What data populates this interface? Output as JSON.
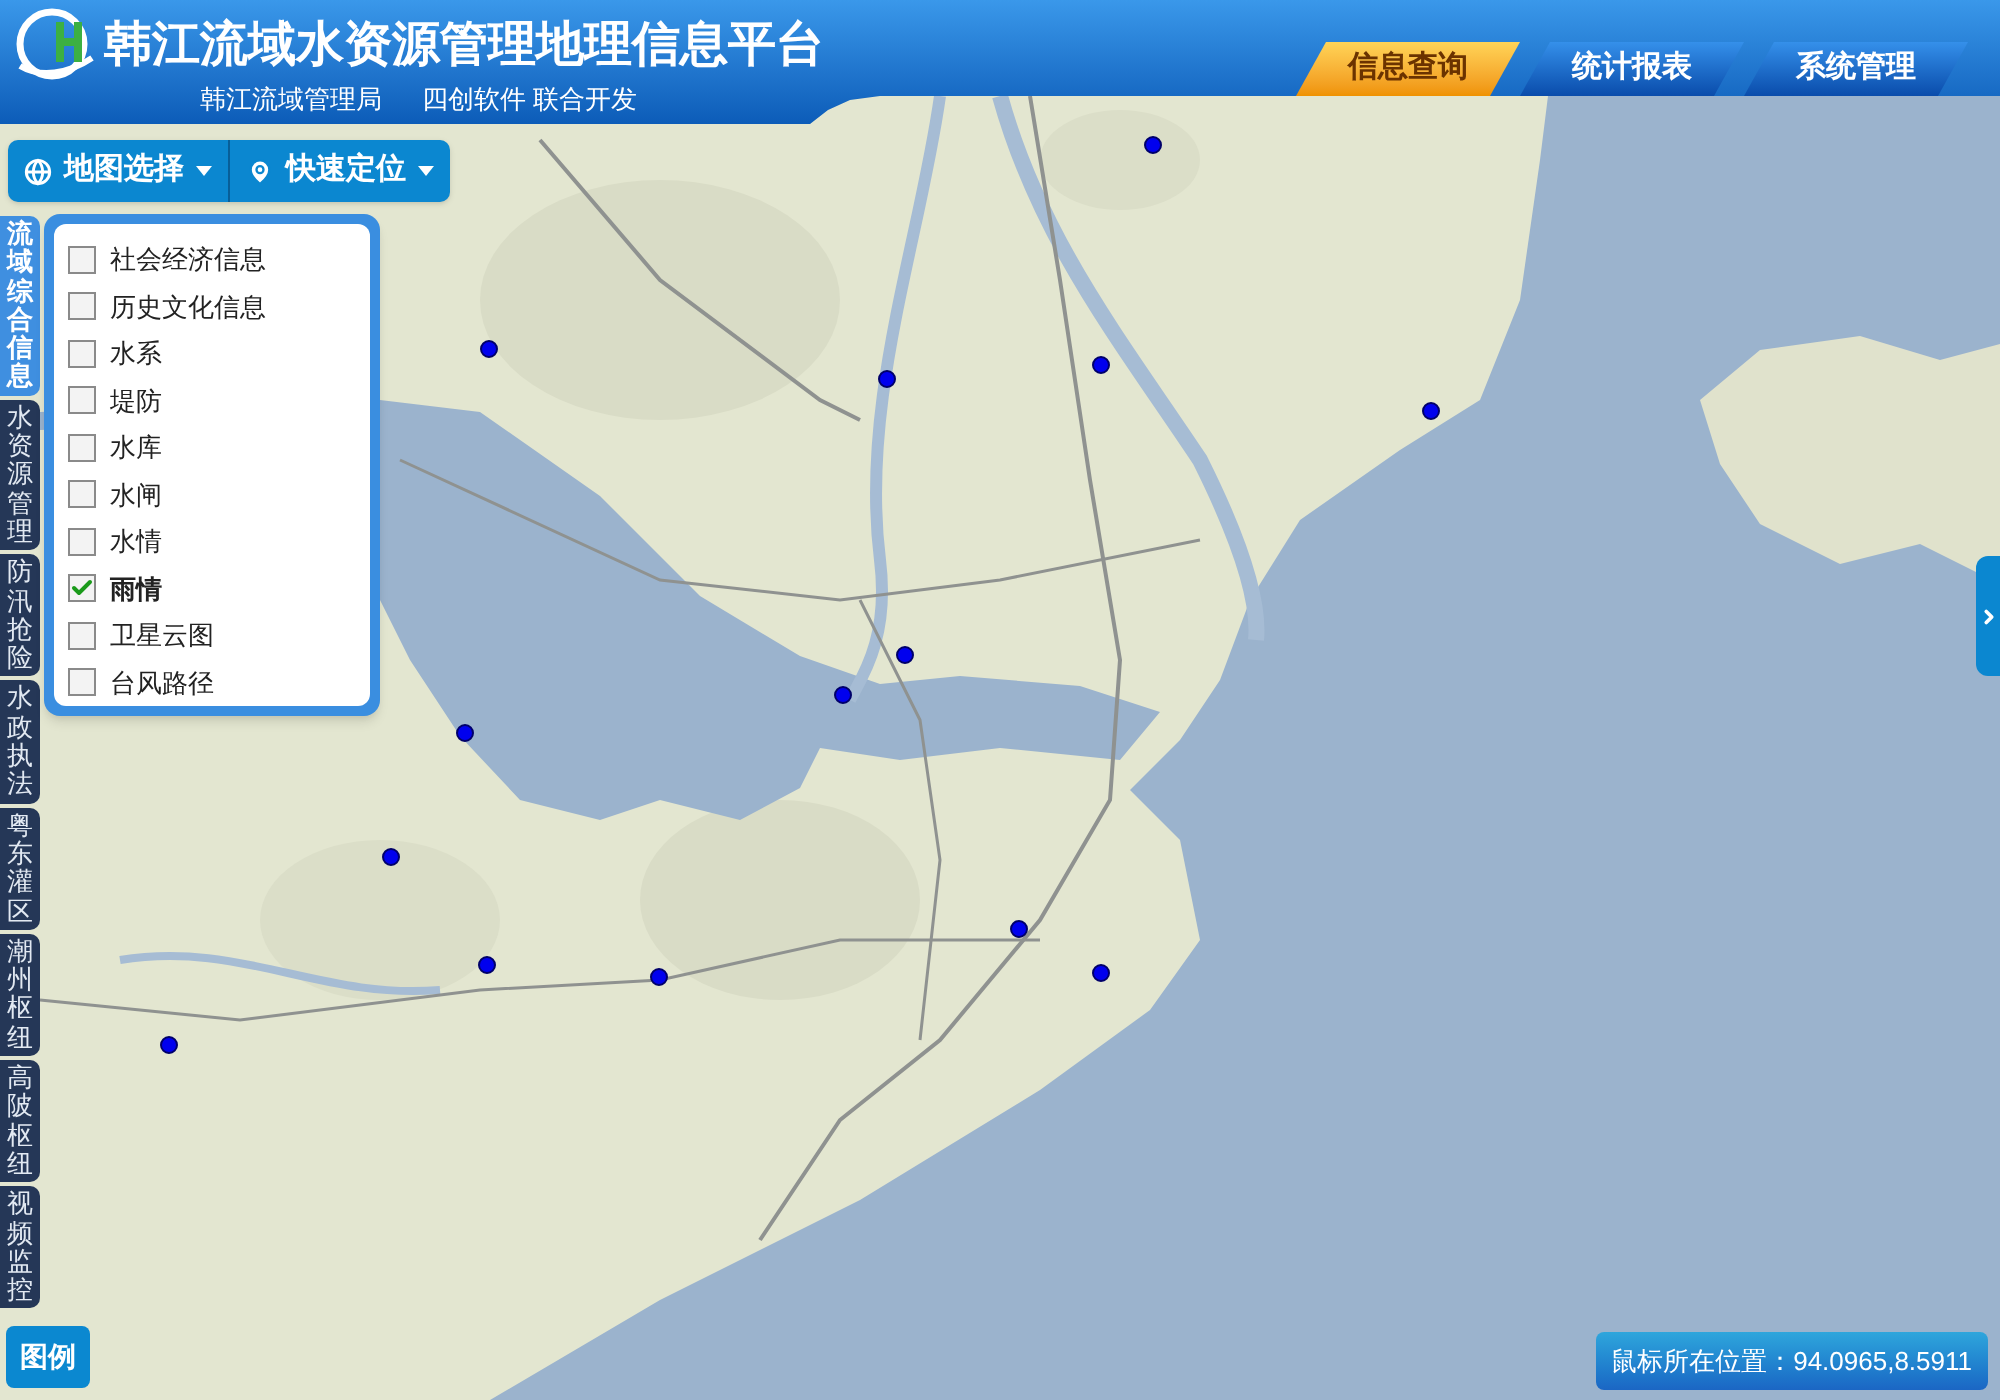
{
  "header": {
    "title": "韩江流域水资源管理地理信息平台",
    "subtitle": [
      "韩江流域管理局",
      "四创软件 联合开发"
    ]
  },
  "nav_tabs": [
    {
      "label": "信息查询",
      "selected": true
    },
    {
      "label": "统计报表",
      "selected": false
    },
    {
      "label": "系统管理",
      "selected": false
    }
  ],
  "toolbar": {
    "buttons": [
      "地图选择",
      "快速定位"
    ]
  },
  "side_tabs": [
    {
      "label": "流域综合信息",
      "selected": true
    },
    {
      "label": "水资源管理",
      "selected": false
    },
    {
      "label": "防汛抢险",
      "selected": false
    },
    {
      "label": "水政执法",
      "selected": false
    },
    {
      "label": "粤东灌区",
      "selected": false
    },
    {
      "label": "潮州枢纽",
      "selected": false
    },
    {
      "label": "高陂枢纽",
      "selected": false
    },
    {
      "label": "视频监控",
      "selected": false
    }
  ],
  "layers": [
    {
      "label": "社会经济信息",
      "checked": false
    },
    {
      "label": "历史文化信息",
      "checked": false
    },
    {
      "label": "水系",
      "checked": false
    },
    {
      "label": "堤防",
      "checked": false
    },
    {
      "label": "水库",
      "checked": false
    },
    {
      "label": "水闸",
      "checked": false
    },
    {
      "label": "水情",
      "checked": false
    },
    {
      "label": "雨情",
      "checked": true
    },
    {
      "label": "卫星云图",
      "checked": false
    },
    {
      "label": "台风路径",
      "checked": false
    }
  ],
  "legend_button": "图例",
  "status_bar": {
    "text": "鼠标所在位置：94.0965,8.5911"
  }
}
